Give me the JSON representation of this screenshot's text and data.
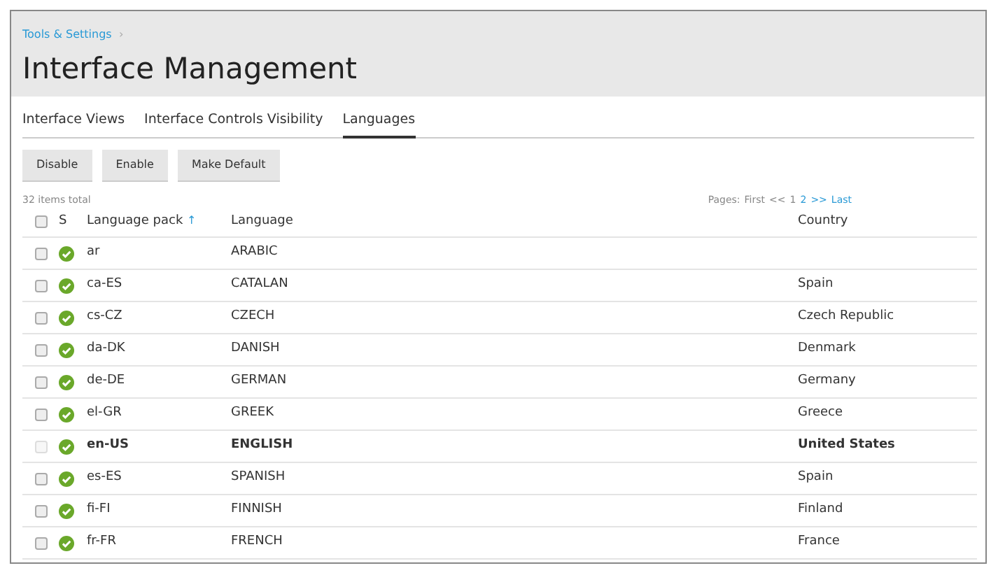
{
  "breadcrumb": {
    "text": "Tools & Settings",
    "separator": "›"
  },
  "title": "Interface Management",
  "tabs": [
    {
      "label": "Interface Views",
      "selected": false
    },
    {
      "label": "Interface Controls Visibility",
      "selected": false
    },
    {
      "label": "Languages",
      "selected": true
    }
  ],
  "buttons": [
    "Disable",
    "Enable",
    "Make Default"
  ],
  "items_total": "32 items total",
  "pager": {
    "label": "Pages:",
    "links": [
      {
        "text": "First",
        "disabled": true
      },
      {
        "text": "<<",
        "disabled": true
      },
      {
        "text": "1",
        "disabled": true
      },
      {
        "text": "2",
        "disabled": false
      },
      {
        "text": ">>",
        "disabled": false
      },
      {
        "text": "Last",
        "disabled": false
      }
    ]
  },
  "table": {
    "columns": [
      {
        "label": "S"
      },
      {
        "label": "Language pack",
        "sort": "↑"
      },
      {
        "label": "Language"
      },
      {
        "label": "Country"
      }
    ],
    "select_all": {
      "checked": false
    },
    "rows": [
      {
        "pack": "ar",
        "language": "ARABIC",
        "country": "",
        "enabled": true,
        "default": false,
        "checked": false
      },
      {
        "pack": "ca-ES",
        "language": "CATALAN",
        "country": "Spain",
        "enabled": true,
        "default": false,
        "checked": false
      },
      {
        "pack": "cs-CZ",
        "language": "CZECH",
        "country": "Czech Republic",
        "enabled": true,
        "default": false,
        "checked": false
      },
      {
        "pack": "da-DK",
        "language": "DANISH",
        "country": "Denmark",
        "enabled": true,
        "default": false,
        "checked": false
      },
      {
        "pack": "de-DE",
        "language": "GERMAN",
        "country": "Germany",
        "enabled": true,
        "default": false,
        "checked": false
      },
      {
        "pack": "el-GR",
        "language": "GREEK",
        "country": "Greece",
        "enabled": true,
        "default": false,
        "checked": false
      },
      {
        "pack": "en-US",
        "language": "ENGLISH",
        "country": "United States",
        "enabled": true,
        "default": true,
        "checked": false
      },
      {
        "pack": "es-ES",
        "language": "SPANISH",
        "country": "Spain",
        "enabled": true,
        "default": false,
        "checked": false
      },
      {
        "pack": "fi-FI",
        "language": "FINNISH",
        "country": "Finland",
        "enabled": true,
        "default": false,
        "checked": false
      },
      {
        "pack": "fr-FR",
        "language": "FRENCH",
        "country": "France",
        "enabled": true,
        "default": false,
        "checked": false
      }
    ]
  }
}
